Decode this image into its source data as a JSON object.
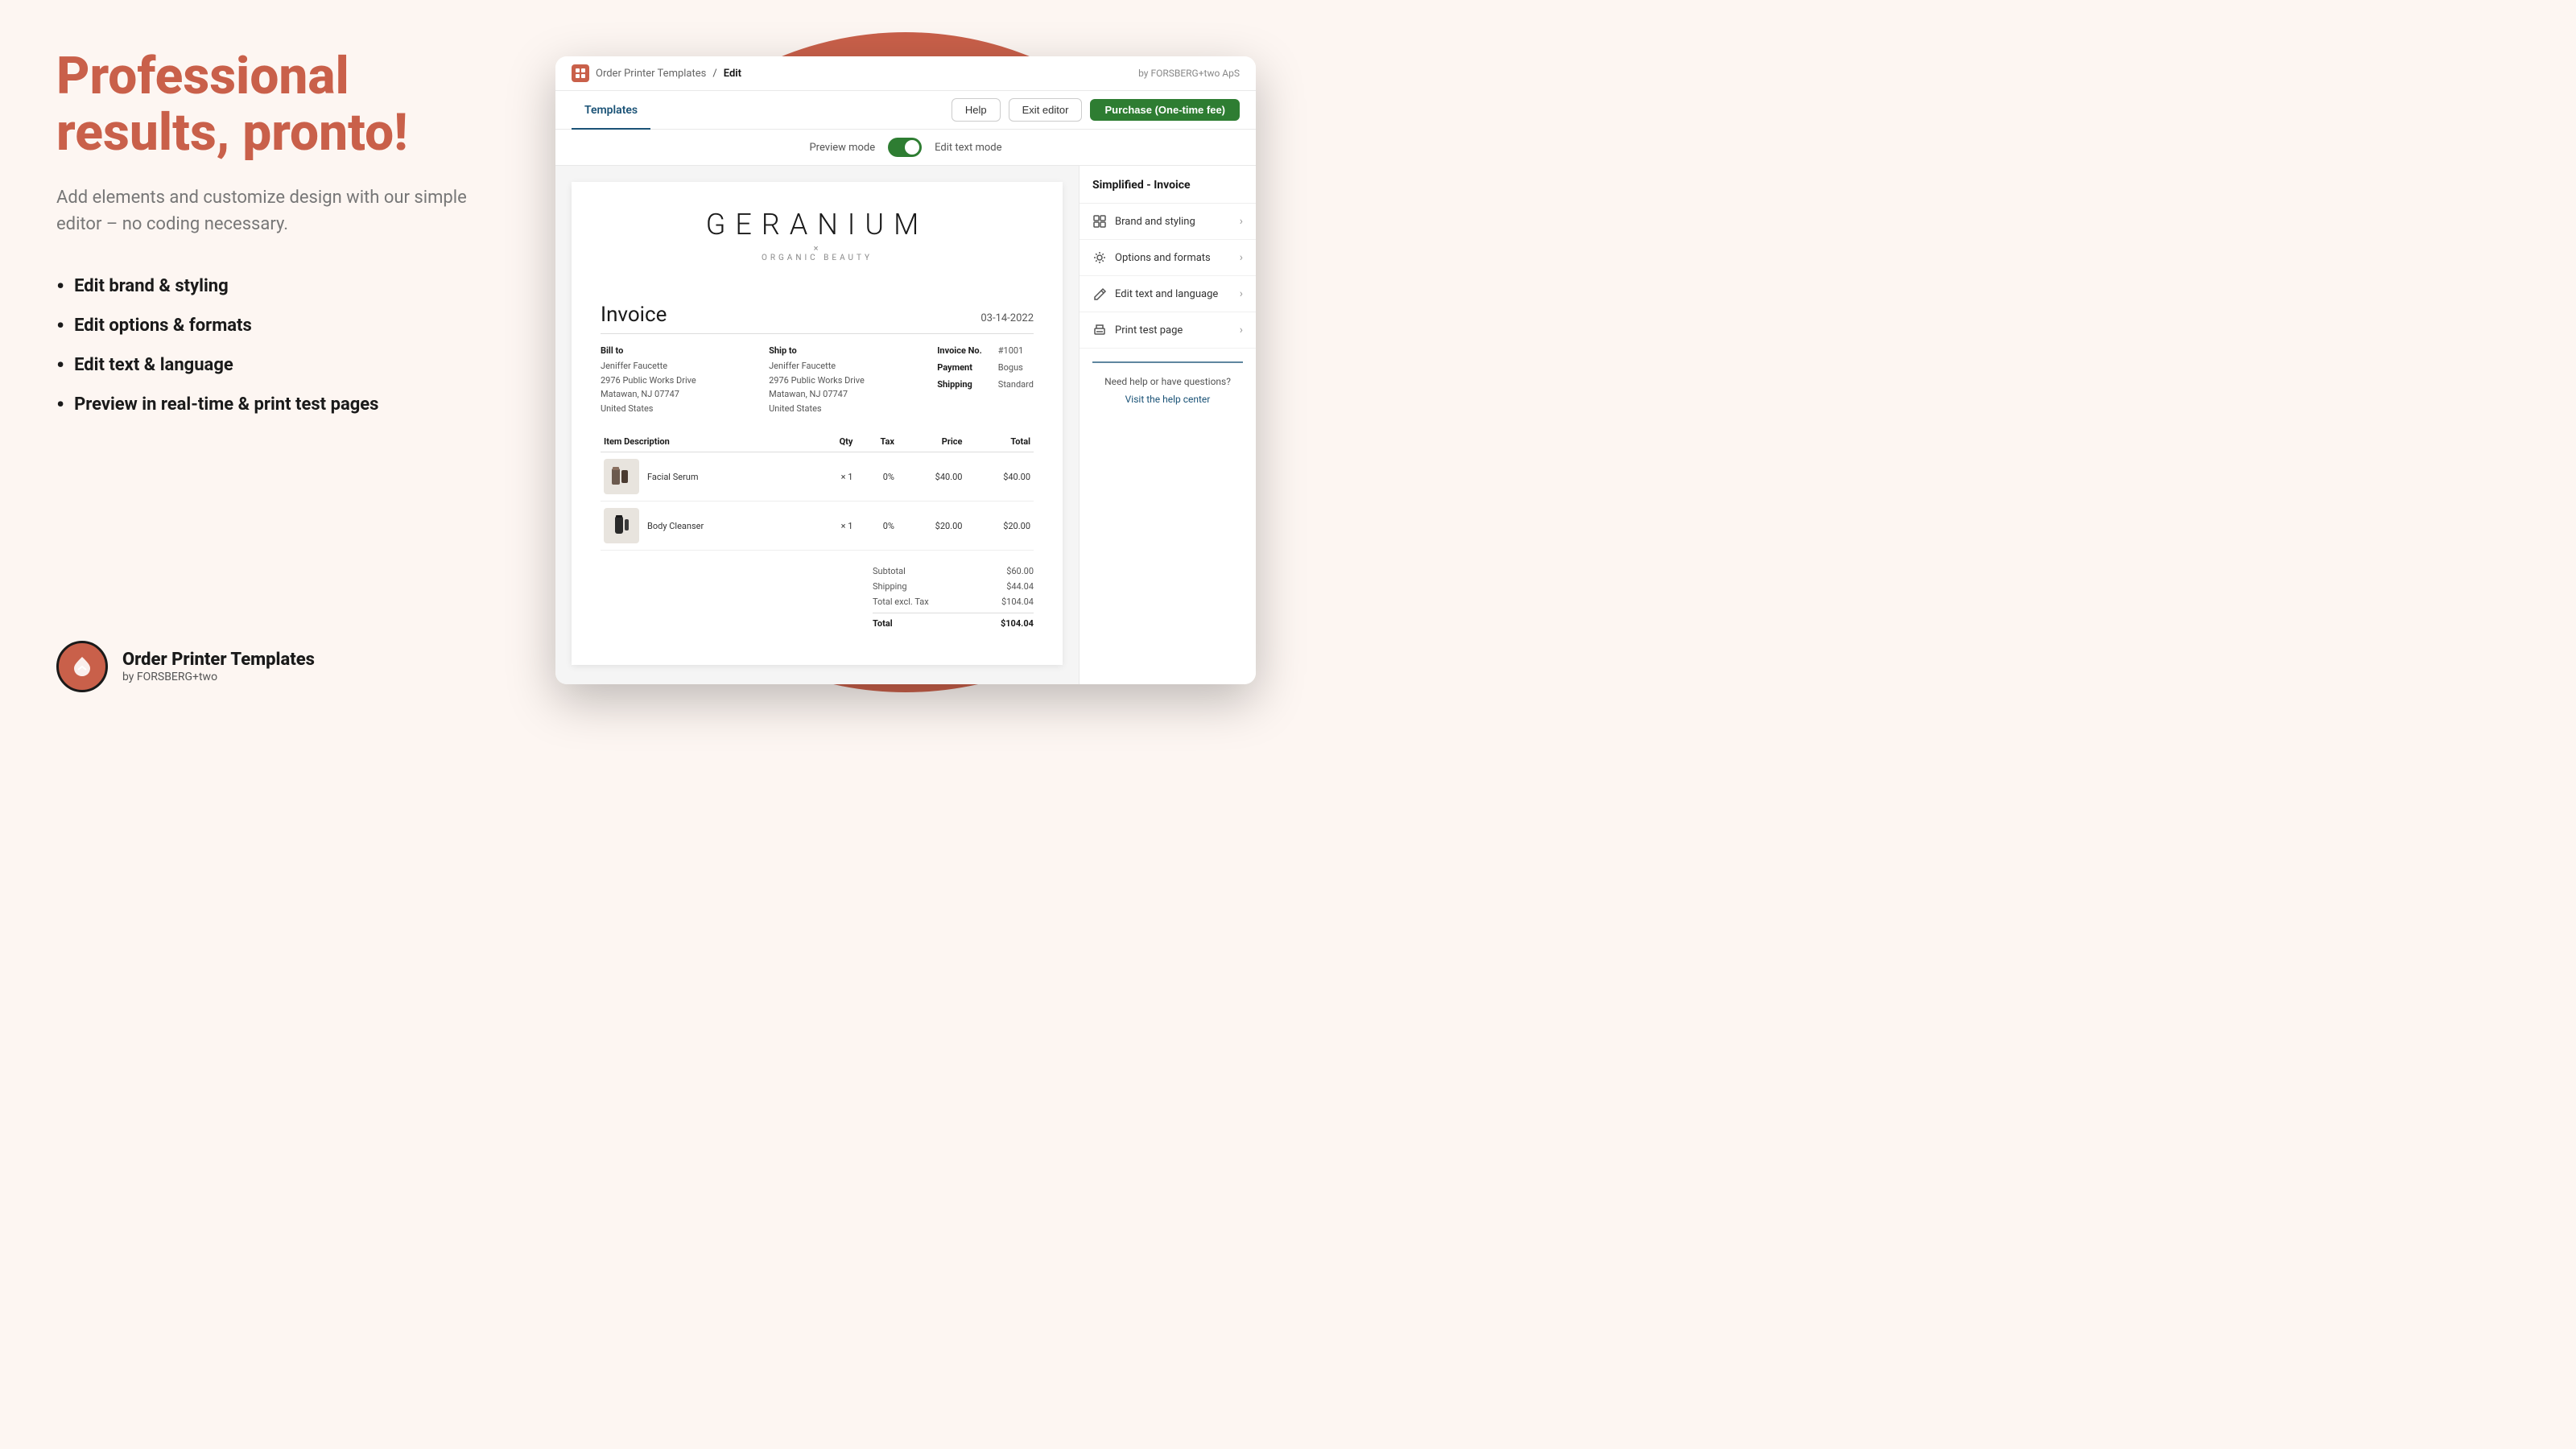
{
  "left": {
    "headline": "Professional results, pronto!",
    "subtext": "Add elements and customize design with our simple editor – no coding necessary.",
    "bullets": [
      "Edit brand & styling",
      "Edit options & formats",
      "Edit text & language",
      "Preview in real-time & print test pages"
    ],
    "brand": {
      "name": "Order Printer Templates",
      "sub": "by FORSBERG+two"
    }
  },
  "app": {
    "topbar": {
      "breadcrumb_base": "Order Printer Templates",
      "separator": "/",
      "breadcrumb_current": "Edit",
      "by": "by FORSBERG+two ApS"
    },
    "navbar": {
      "tab_templates": "Templates",
      "btn_help": "Help",
      "btn_exit": "Exit editor",
      "btn_purchase": "Purchase (One-time fee)"
    },
    "modebar": {
      "preview_label": "Preview mode",
      "edit_label": "Edit text mode"
    },
    "invoice": {
      "brand_name": "GERANIUM",
      "brand_x": "×",
      "brand_organic": "ORGANIC BEAUTY",
      "title": "Invoice",
      "date": "03-14-2022",
      "bill_to_label": "Bill to",
      "ship_to_label": "Ship to",
      "invoice_no_label": "Invoice No.",
      "invoice_no_value": "#1001",
      "payment_label": "Payment",
      "payment_value": "Bogus",
      "shipping_label": "Shipping",
      "shipping_value": "Standard",
      "bill_name": "Jeniffer Faucette",
      "bill_addr1": "2976 Public Works Drive",
      "bill_addr2": "Matawan, NJ 07747",
      "bill_addr3": "United States",
      "ship_name": "Jeniffer Faucette",
      "ship_addr1": "2976 Public Works Drive",
      "ship_addr2": "Matawan, NJ 07747",
      "ship_addr3": "United States",
      "col_item": "Item Description",
      "col_qty": "Qty",
      "col_tax": "Tax",
      "col_price": "Price",
      "col_total": "Total",
      "items": [
        {
          "name": "Facial Serum",
          "qty": "× 1",
          "tax": "0%",
          "price": "$40.00",
          "total": "$40.00"
        },
        {
          "name": "Body Cleanser",
          "qty": "× 1",
          "tax": "0%",
          "price": "$20.00",
          "total": "$20.00"
        }
      ],
      "subtotal_label": "Subtotal",
      "subtotal_value": "$60.00",
      "shipping_fee_label": "Shipping",
      "shipping_fee_value": "$44.04",
      "total_excl_label": "Total excl. Tax",
      "total_excl_value": "$104.04",
      "grand_total_label": "Total",
      "grand_total_value": "$104.04"
    },
    "sidebar": {
      "title": "Simplified - Invoice",
      "items": [
        {
          "label": "Brand and styling",
          "icon": "brand-icon"
        },
        {
          "label": "Options and formats",
          "icon": "options-icon"
        },
        {
          "label": "Edit text and language",
          "icon": "edit-icon"
        },
        {
          "label": "Print test page",
          "icon": "print-icon"
        }
      ],
      "help_text": "Need help or have questions?",
      "help_link": "Visit the help center"
    }
  }
}
